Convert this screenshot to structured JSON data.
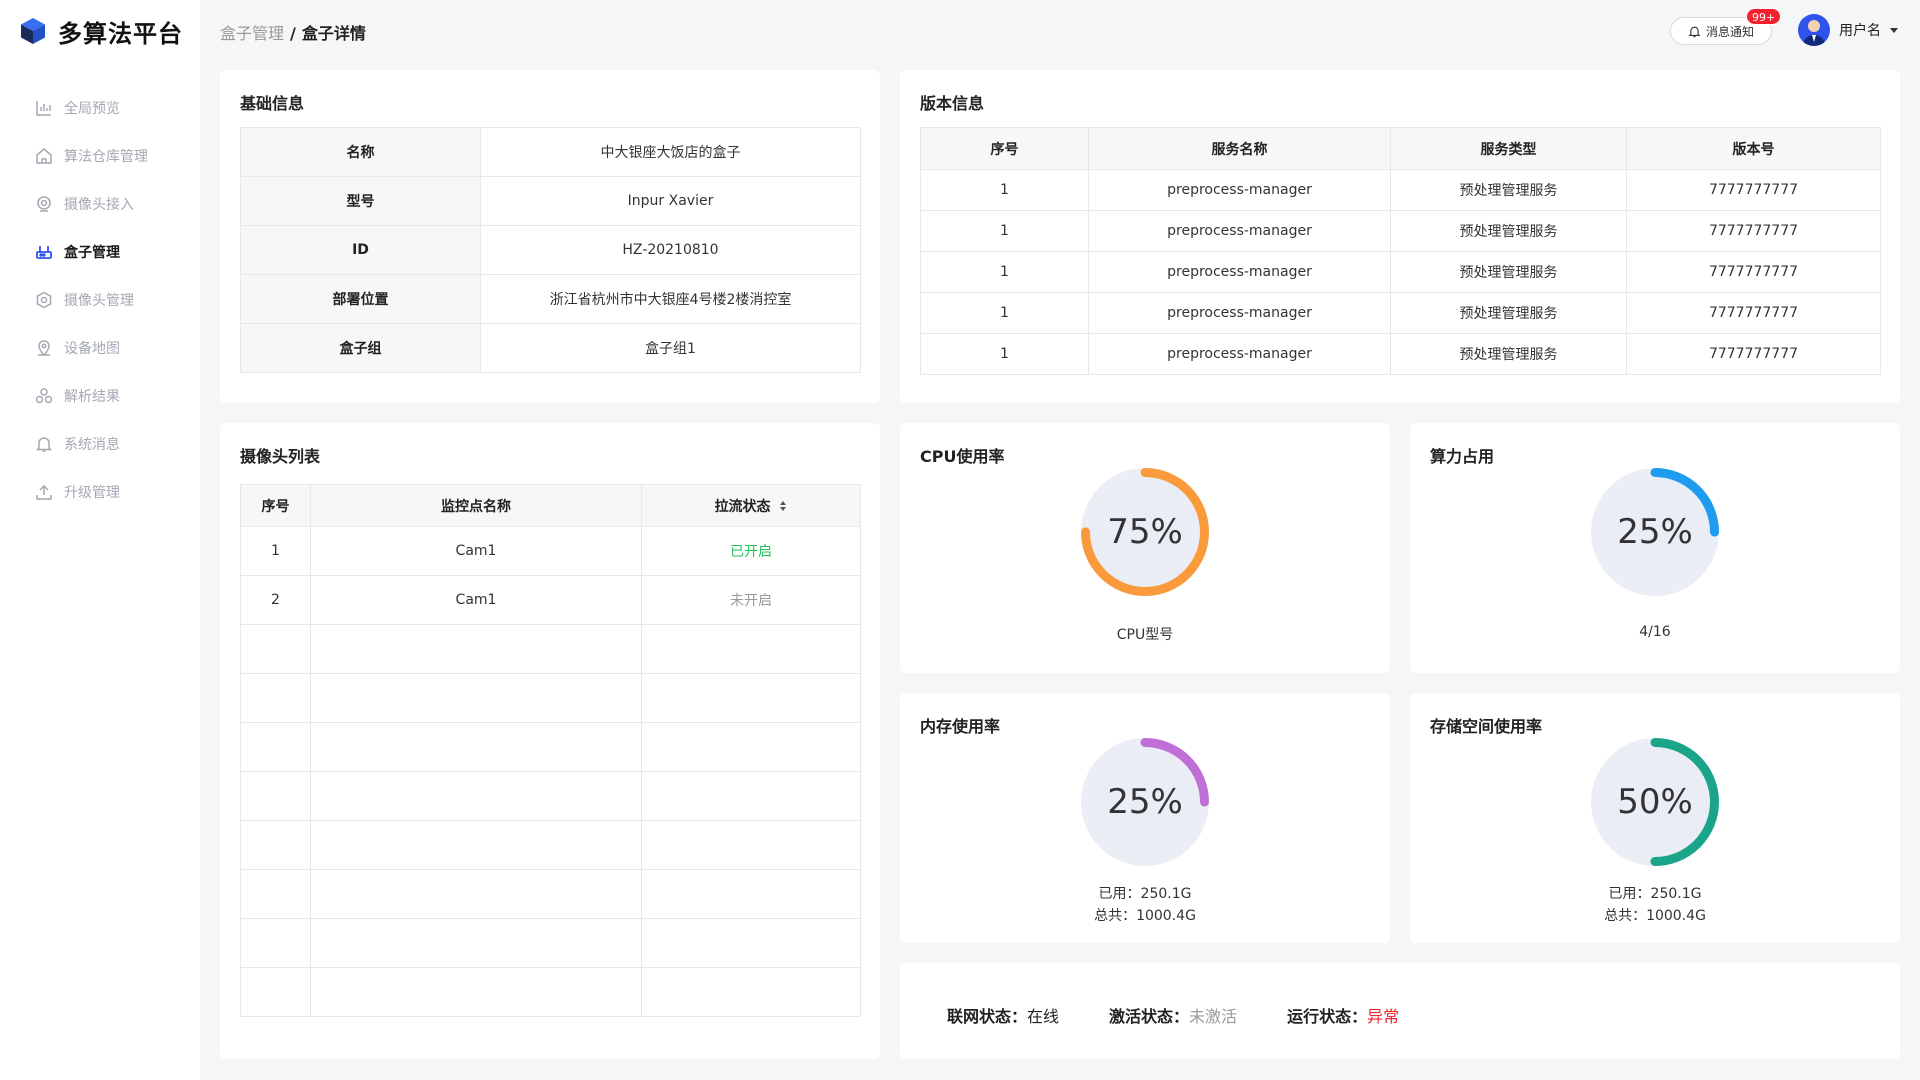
{
  "app": {
    "title": "多算法平台"
  },
  "sidebar": {
    "items": [
      {
        "label": "全局预览",
        "icon": "bar-chart-icon"
      },
      {
        "label": "算法仓库管理",
        "icon": "home-icon"
      },
      {
        "label": "摄像头接入",
        "icon": "camera-pin-icon"
      },
      {
        "label": "盒子管理",
        "icon": "router-box-icon",
        "active": true
      },
      {
        "label": "摄像头管理",
        "icon": "hexagon-icon"
      },
      {
        "label": "设备地图",
        "icon": "map-pin-icon"
      },
      {
        "label": "解析结果",
        "icon": "nodes-icon"
      },
      {
        "label": "系统消息",
        "icon": "bell-icon"
      },
      {
        "label": "升级管理",
        "icon": "upload-icon"
      }
    ]
  },
  "header": {
    "breadcrumb_parent": "盒子管理",
    "breadcrumb_sep": "/",
    "breadcrumb_current": "盒子详情",
    "notify_label": "消息通知",
    "notify_badge": "99+",
    "user_name": "用户名"
  },
  "basic_info": {
    "title": "基础信息",
    "rows": [
      {
        "key": "名称",
        "value": "中大银座大饭店的盒子"
      },
      {
        "key": "型号",
        "value": "Inpur Xavier"
      },
      {
        "key": "ID",
        "value": "HZ-20210810"
      },
      {
        "key": "部署位置",
        "value": "浙江省杭州市中大银座4号楼2楼消控室"
      },
      {
        "key": "盒子组",
        "value": "盒子组1"
      }
    ]
  },
  "version_info": {
    "title": "版本信息",
    "columns": [
      "序号",
      "服务名称",
      "服务类型",
      "版本号"
    ],
    "rows": [
      [
        "1",
        "preprocess-manager",
        "预处理管理服务",
        "7777777777"
      ],
      [
        "1",
        "preprocess-manager",
        "预处理管理服务",
        "7777777777"
      ],
      [
        "1",
        "preprocess-manager",
        "预处理管理服务",
        "7777777777"
      ],
      [
        "1",
        "preprocess-manager",
        "预处理管理服务",
        "7777777777"
      ],
      [
        "1",
        "preprocess-manager",
        "预处理管理服务",
        "7777777777"
      ]
    ]
  },
  "camera_list": {
    "title": "摄像头列表",
    "columns": [
      "序号",
      "监控点名称",
      "拉流状态"
    ],
    "rows": [
      {
        "index": "1",
        "name": "Cam1",
        "status": "已开启",
        "status_color": "#21c05b"
      },
      {
        "index": "2",
        "name": "Cam1",
        "status": "未开启",
        "status_color": "#9a9a9a"
      }
    ]
  },
  "cpu": {
    "title": "CPU使用率",
    "percent_text": "75%",
    "value": 0.75,
    "color": "#fa9a3c",
    "sub": "CPU型号"
  },
  "compute": {
    "title": "算力占用",
    "percent_text": "25%",
    "value": 0.25,
    "color": "#1f9bf0",
    "sub": "4/16"
  },
  "memory": {
    "title": "内存使用率",
    "percent_text": "25%",
    "value": 0.25,
    "color": "#c06fd6",
    "used": "已用：250.1G",
    "total": "总共：1000.4G"
  },
  "storage": {
    "title": "存储空间使用率",
    "percent_text": "50%",
    "value": 0.5,
    "color": "#1aa58a",
    "used": "已用：250.1G",
    "total": "总共：1000.4G"
  },
  "status": {
    "network_label": "联网状态：",
    "network_value": "在线",
    "activation_label": "激活状态：",
    "activation_value": "未激活",
    "running_label": "运行状态：",
    "running_value": "异常",
    "running_color": "#f5222d"
  }
}
